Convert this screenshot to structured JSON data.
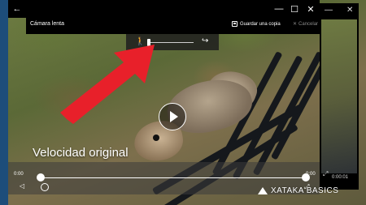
{
  "window": {
    "title": "Cámara lenta",
    "save_copy_label": "Guardar una copia",
    "cancel_label": "Cancelar"
  },
  "speed": {
    "label": "Velocidad original",
    "level": 0.0
  },
  "playback": {
    "time_start": "0:00",
    "time_end": "0:00",
    "progress": 0.0
  },
  "second_window": {
    "time": "0:00:01"
  },
  "watermark": {
    "text": "XATAKA BASICS"
  },
  "icons": {
    "back": "back-arrow-icon",
    "minimize": "minimize-icon",
    "maximize": "maximize-icon",
    "close": "close-icon",
    "save": "save-icon",
    "cancel": "cancel-x-icon",
    "slow": "walking-person-icon",
    "fast": "rabbit-icon",
    "play": "play-icon",
    "volume": "volume-icon",
    "expand": "expand-icon"
  },
  "colors": {
    "annotation_arrow": "#e8202a",
    "titlebar": "#000000"
  }
}
